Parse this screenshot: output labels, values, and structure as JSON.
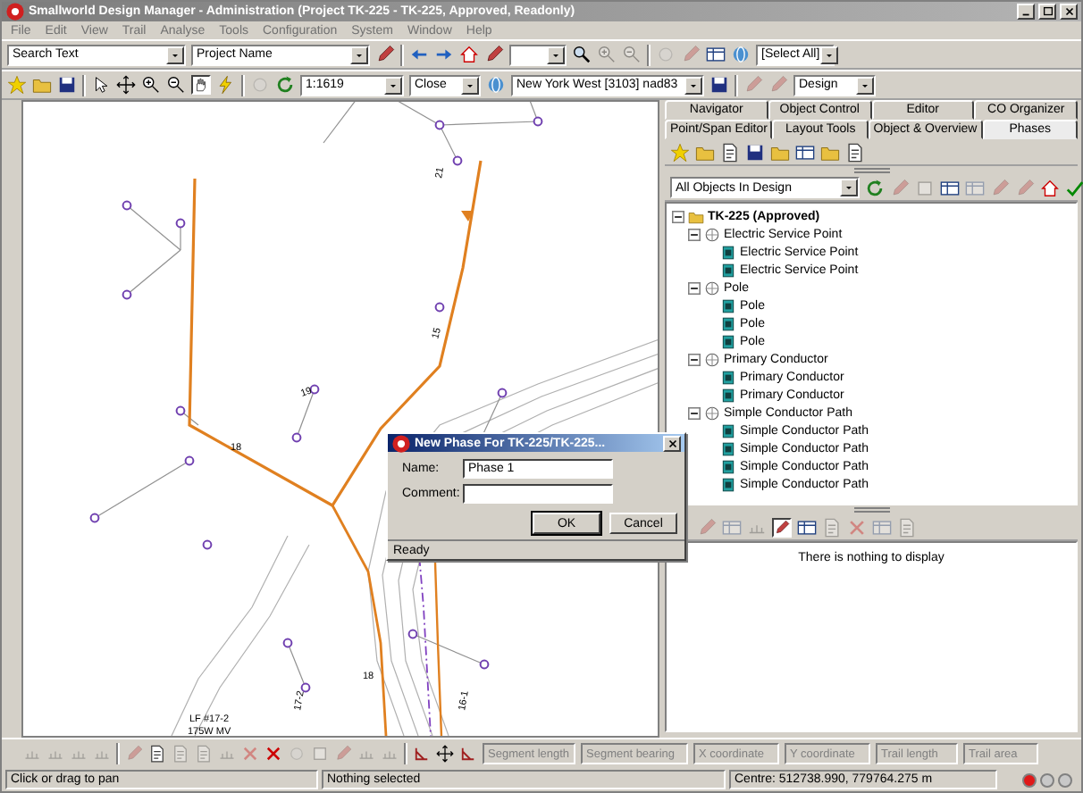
{
  "window": {
    "title": "Smallworld Design Manager - Administration (Project TK-225 - TK-225, Approved, Readonly)"
  },
  "menu": [
    "File",
    "Edit",
    "View",
    "Trail",
    "Analyse",
    "Tools",
    "Configuration",
    "System",
    "Window",
    "Help"
  ],
  "toolbar": {
    "search": "Search Text",
    "project": "Project Name",
    "selection": "[Select All]",
    "scale": "1:1619",
    "close": "Close",
    "coordinate_system": "New York West [3103] nad83",
    "mode": "Design"
  },
  "map": {
    "labels": [
      "21",
      "15",
      "19",
      "18",
      "18",
      "LF #17-2",
      "175W MV",
      "17-2",
      "16-1"
    ]
  },
  "panel": {
    "tab_rows": [
      [
        {
          "label": "Navigator",
          "selected": false
        },
        {
          "label": "Object Control",
          "selected": false
        },
        {
          "label": "Editor",
          "selected": false
        },
        {
          "label": "CO Organizer",
          "selected": false
        }
      ],
      [
        {
          "label": "Point/Span Editor",
          "selected": false
        },
        {
          "label": "Layout Tools",
          "selected": false
        },
        {
          "label": "Object & Overview",
          "selected": false
        },
        {
          "label": "Phases",
          "selected": true
        }
      ]
    ],
    "filter": "All Objects In Design",
    "tree": [
      {
        "label": "TK-225 (Approved)",
        "kind": "folder",
        "expanded": true,
        "children": [
          {
            "label": "Electric Service Point",
            "kind": "group",
            "expanded": true,
            "children": [
              {
                "label": "Electric Service Point",
                "kind": "item"
              },
              {
                "label": "Electric Service Point",
                "kind": "item"
              }
            ]
          },
          {
            "label": "Pole",
            "kind": "group",
            "expanded": true,
            "children": [
              {
                "label": "Pole",
                "kind": "item"
              },
              {
                "label": "Pole",
                "kind": "item"
              },
              {
                "label": "Pole",
                "kind": "item"
              }
            ]
          },
          {
            "label": "Primary Conductor",
            "kind": "group",
            "expanded": true,
            "children": [
              {
                "label": "Primary Conductor",
                "kind": "item"
              },
              {
                "label": "Primary Conductor",
                "kind": "item"
              }
            ]
          },
          {
            "label": "Simple Conductor Path",
            "kind": "group",
            "expanded": true,
            "children": [
              {
                "label": "Simple Conductor Path",
                "kind": "item"
              },
              {
                "label": "Simple Conductor Path",
                "kind": "item"
              },
              {
                "label": "Simple Conductor Path",
                "kind": "item"
              },
              {
                "label": "Simple Conductor Path",
                "kind": "item"
              }
            ]
          }
        ]
      }
    ],
    "details_message": "There is nothing to display"
  },
  "dialog": {
    "title": "New Phase For TK-225/TK-225...",
    "fields": [
      {
        "label": "Name:",
        "value": "Phase 1"
      },
      {
        "label": "Comment:"
      }
    ],
    "buttons": [
      {
        "label": "OK",
        "default": true
      },
      {
        "label": "Cancel",
        "default": false
      }
    ],
    "status": "Ready"
  },
  "measure_fields": [
    {
      "placeholder": "Segment length",
      "disabled": true
    },
    {
      "placeholder": "Segment bearing",
      "disabled": true
    },
    {
      "placeholder": "X coordinate",
      "disabled": true
    },
    {
      "placeholder": "Y coordinate",
      "disabled": true
    },
    {
      "placeholder": "Trail length",
      "disabled": true
    },
    {
      "placeholder": "Trail area",
      "disabled": true
    }
  ],
  "status_bar": {
    "hint": "Click or drag to pan",
    "selection": "Nothing selected",
    "centre": "Centre: 512738.990, 779764.275 m",
    "lights": [
      {
        "color": "#e01818"
      },
      {
        "color": "#c8c8c8"
      },
      {
        "color": "#c8c8c8"
      }
    ]
  }
}
